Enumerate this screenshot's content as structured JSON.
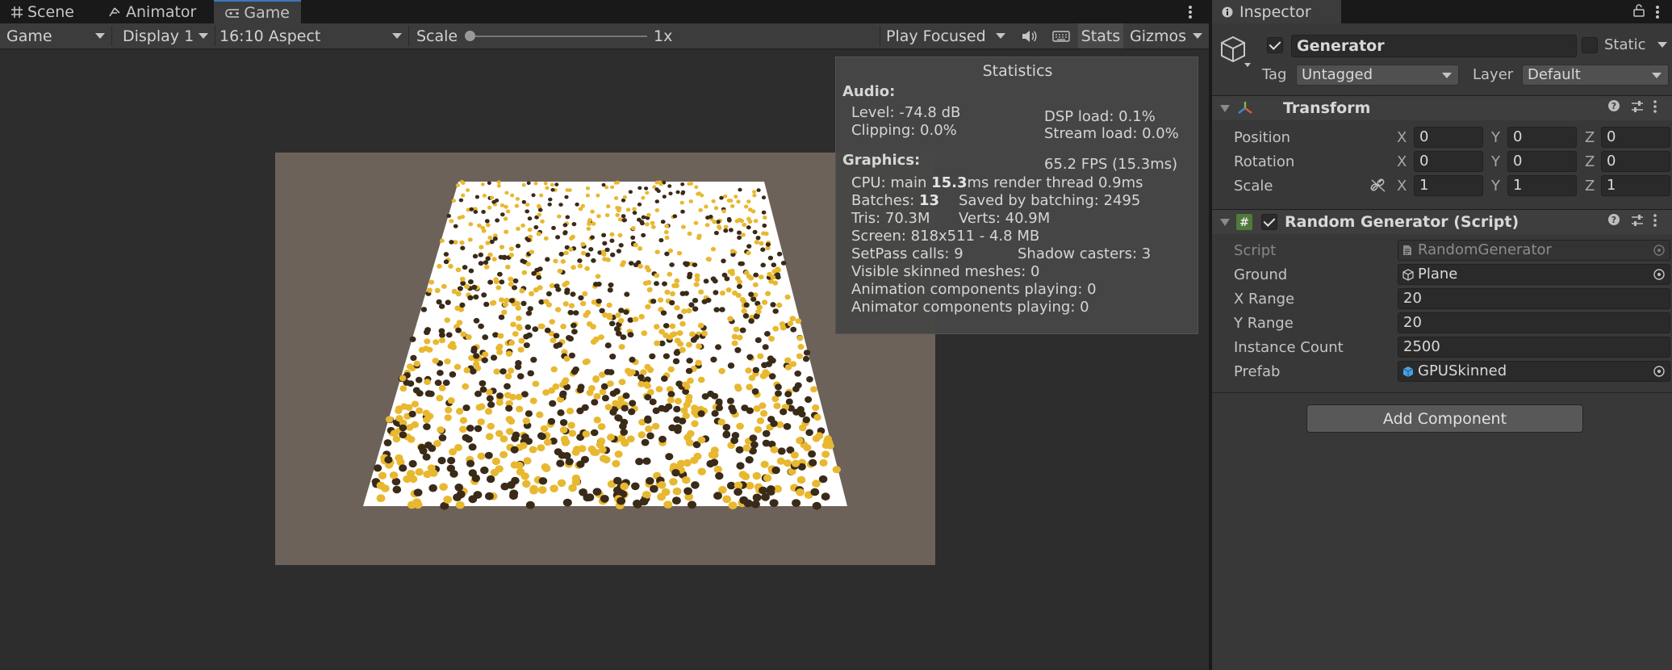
{
  "tabs": [
    {
      "label": "Scene",
      "icon": "grid-icon"
    },
    {
      "label": "Animator",
      "icon": "animator-icon"
    },
    {
      "label": "Game",
      "icon": "gamepad-icon",
      "active": true
    }
  ],
  "toolbar": {
    "view_mode": "Game",
    "display": "Display 1",
    "aspect": "16:10 Aspect",
    "scale_label": "Scale",
    "scale_value": "1x",
    "play_mode": "Play Focused",
    "stats_label": "Stats",
    "gizmos_label": "Gizmos"
  },
  "stats": {
    "title": "Statistics",
    "audio_header": "Audio:",
    "level": "Level: -74.8 dB",
    "clipping": "Clipping: 0.0%",
    "dsp_load": "DSP load: 0.1%",
    "stream_load": "Stream load: 0.0%",
    "graphics_header": "Graphics:",
    "fps": "65.2 FPS (15.3ms)",
    "cpu_prefix": "CPU: main ",
    "cpu_main": "15.3",
    "cpu_suffix": "ms  render thread 0.9ms",
    "batches_prefix": "Batches: ",
    "batches": "13",
    "saved_batching": "Saved by batching: 2495",
    "tris": "Tris: 70.3M",
    "verts": "Verts: 40.9M",
    "screen": "Screen: 818x511 - 4.8 MB",
    "setpass": "SetPass calls: 9",
    "shadow_casters": "Shadow casters: 3",
    "skinned_meshes": "Visible skinned meshes: 0",
    "animation_components": "Animation components playing: 0",
    "animator_components": "Animator components playing: 0"
  },
  "inspector": {
    "tab_label": "Inspector",
    "object_name": "Generator",
    "active": true,
    "static_label": "Static",
    "tag_label": "Tag",
    "tag_value": "Untagged",
    "layer_label": "Layer",
    "layer_value": "Default",
    "transform": {
      "title": "Transform",
      "position": {
        "label": "Position",
        "x": "0",
        "y": "0",
        "z": "0"
      },
      "rotation": {
        "label": "Rotation",
        "x": "0",
        "y": "0",
        "z": "0"
      },
      "scale": {
        "label": "Scale",
        "x": "1",
        "y": "1",
        "z": "1"
      }
    },
    "script_component": {
      "title": "Random Generator (Script)",
      "enabled": true,
      "fields": [
        {
          "label": "Script",
          "value": "RandomGenerator",
          "kind": "object",
          "icon": "script-icon",
          "disabled": true
        },
        {
          "label": "Ground",
          "value": "Plane",
          "kind": "object",
          "icon": "mesh-icon"
        },
        {
          "label": "X Range",
          "value": "20",
          "kind": "text"
        },
        {
          "label": "Y Range",
          "value": "20",
          "kind": "text"
        },
        {
          "label": "Instance Count",
          "value": "2500",
          "kind": "text"
        },
        {
          "label": "Prefab",
          "value": "GPUSkinned",
          "kind": "object",
          "icon": "prefab-icon"
        }
      ]
    },
    "add_component": "Add Component"
  },
  "colors": {
    "editor_bg": "#282828",
    "panel_bg": "#383838",
    "scene_bg": "#6d625a",
    "ground": "#ffffff",
    "instance_yellow": "#e8b830",
    "instance_dark": "#3a2a18",
    "active_tab_accent": "#3a79bb"
  }
}
